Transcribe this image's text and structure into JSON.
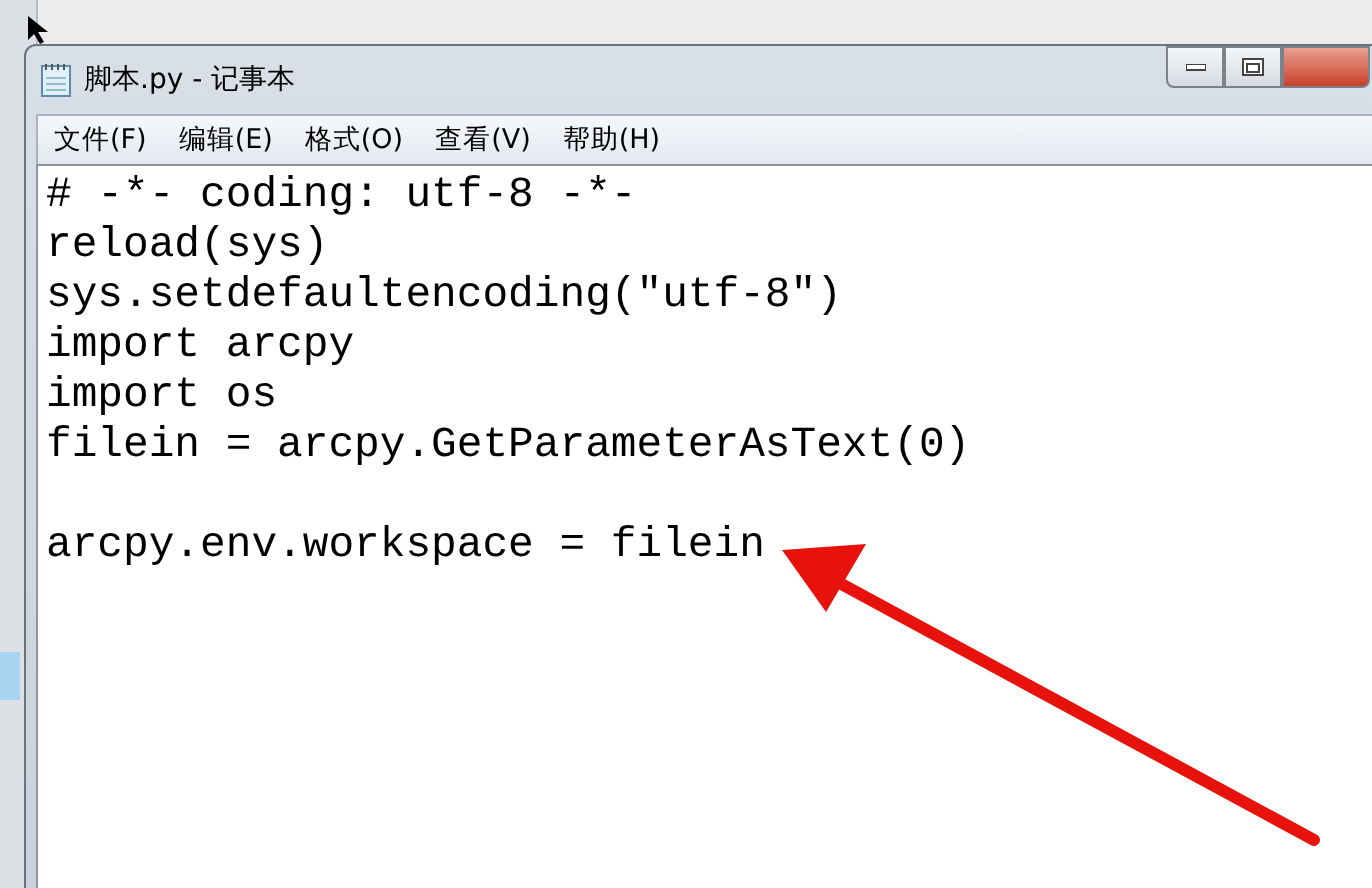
{
  "window": {
    "title": "脚本.py - 记事本"
  },
  "menu": [
    "文件(F)",
    "编辑(E)",
    "格式(O)",
    "查看(V)",
    "帮助(H)"
  ],
  "editor": {
    "text": "# -*- coding: utf-8 -*-\nreload(sys)\nsys.setdefaultencoding(\"utf-8\")\nimport arcpy\nimport os\nfilein = arcpy.GetParameterAsText(0)\n\narcpy.env.workspace = filein"
  }
}
